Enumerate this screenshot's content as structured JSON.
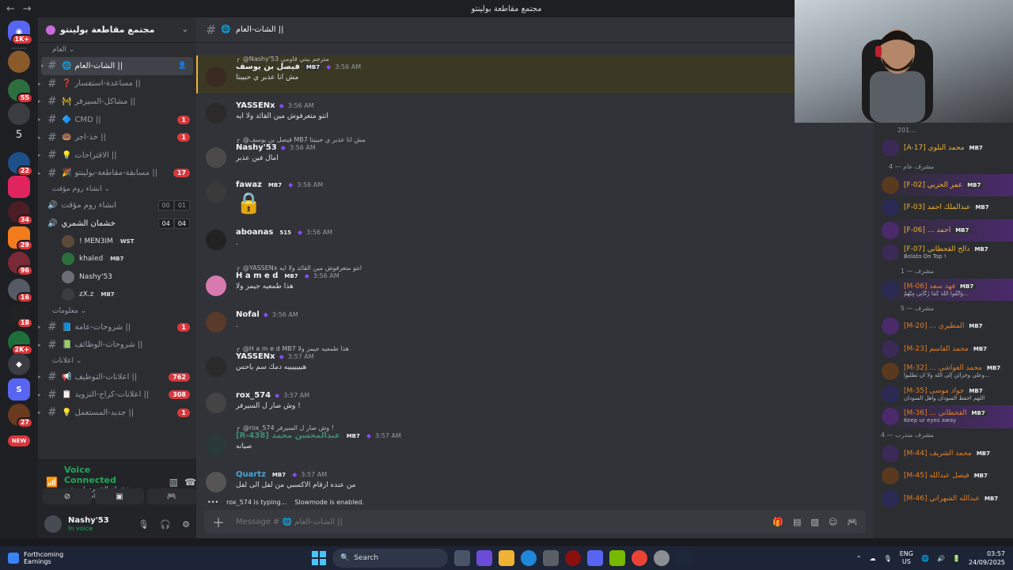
{
  "window": {
    "title": "مجتمع مقاطعة بولينتو"
  },
  "rail": {
    "badges": [
      "1K+",
      "55",
      "5",
      "22",
      "34",
      "29",
      "96",
      "16",
      "18",
      "2K+",
      "27",
      "NEW"
    ]
  },
  "server": {
    "name": "مجتمع مقاطعة بولينتو"
  },
  "sidebar": {
    "cat_general": "العام",
    "channels_general": [
      {
        "label": "الشات-العام ||",
        "emoji": "🌐",
        "active": true
      },
      {
        "label": "مساعدة-استفسار ||",
        "emoji": "❓"
      },
      {
        "label": "مشاكل-السيرفر ||",
        "emoji": "🚧"
      },
      {
        "label": "CMD ||",
        "emoji": "🔷",
        "unread": "1"
      },
      {
        "label": "خذ-اجر ||",
        "emoji": "🍩",
        "unread": "1"
      },
      {
        "label": "الاقتراحات ||",
        "emoji": "💡"
      },
      {
        "label": "مسابقة-مقاطعة-بولينتو ||",
        "emoji": "🎉",
        "unread": "17"
      }
    ],
    "cat_rooms": "انشاء روم مؤقت",
    "voice_create": {
      "label": "انشاء روم مؤقت",
      "c1": "00",
      "c2": "01"
    },
    "voice_room": {
      "label": "خشمان الشمري",
      "c1": "04",
      "c2": "04"
    },
    "voice_users": [
      {
        "name": "! MEN3IM",
        "tag": "WST"
      },
      {
        "name": "khaled",
        "tag": "MB7"
      },
      {
        "name": "Nashy'53",
        "tag": ""
      },
      {
        "name": "zX.z",
        "tag": "MB7"
      }
    ],
    "cat_info": "معلومات",
    "channels_info": [
      {
        "label": "شروحات-عامة ||",
        "emoji": "📘",
        "unread": "1"
      },
      {
        "label": "شروحات-الوظائف ||",
        "emoji": "📗"
      }
    ],
    "cat_ads": "اعلانات",
    "channels_ads": [
      {
        "label": "اعلانات-التوظيف ||",
        "emoji": "📢",
        "unread": "762"
      },
      {
        "label": "اعلانات-كراج-التزويد ||",
        "emoji": "📋",
        "unread": "308"
      },
      {
        "label": "جديد-المستعمل ||",
        "emoji": "💡",
        "unread": "1"
      }
    ]
  },
  "voice_panel": {
    "title": "Voice Connected",
    "subtitle": "خشمان الشمري / مجتمع مقاطعة بولينتو"
  },
  "user_panel": {
    "name": "Nashy'53",
    "status": "In voice"
  },
  "chat": {
    "channel": "الشات-العام ||",
    "messages": [
      {
        "reply": "@Nashy'53 مترجم يبتي قاومي",
        "name": "فيصل بن يوسف",
        "badge": "MB7",
        "time": "3:56 AM",
        "body": "مش انا عذبر ي حبيبتا"
      },
      {
        "reply": "",
        "name": "YASSENx",
        "badge": "",
        "time": "3:56 AM",
        "body": "انتو متعرفوش مين القائد ولا ايه"
      },
      {
        "reply": "@فيصل بن يوسف MB7 مش انا عذبر ي حبيبتا",
        "name": "Nashy'53",
        "badge": "",
        "time": "3:56 AM",
        "body": "امال فين عذبر"
      },
      {
        "reply": "",
        "name": "fawaz",
        "badge": "MB7",
        "time": "3:56 AM",
        "body": "🔒"
      },
      {
        "reply": "",
        "name": "aboanas",
        "badge": "515",
        "time": "3:56 AM",
        "body": "."
      },
      {
        "reply": "@YASSENx انتو متعرفوش مين القائد ولا ايه",
        "name": "H a m e d",
        "badge": "MB7",
        "time": "3:56 AM",
        "body": "هذا طمعيه جيمز ولا"
      },
      {
        "reply": "",
        "name": "Nofal",
        "badge": "",
        "time": "3:56 AM",
        "body": "."
      },
      {
        "reply": "@H a m e d MB7 هذا طمعيه جيمز ولا",
        "name": "YASSENx",
        "badge": "",
        "time": "3:57 AM",
        "body": "هيييييييه دمك سم ياحس"
      },
      {
        "reply": "",
        "name": "rox_574",
        "badge": "",
        "time": "3:57 AM",
        "body": "وش صار ل السيرفر !"
      },
      {
        "reply": "@rox_574 وش صار ل السيرفر !",
        "name": "[R-438] عبدالمحسن محمد",
        "badge": "MB7",
        "time": "3:57 AM",
        "body": "صيانه"
      },
      {
        "reply": "",
        "name": "Quartz",
        "badge": "MB7",
        "time": "3:57 AM",
        "body": "من عنده ارقام الاكسبي من لفل الى لفل"
      }
    ],
    "typing": "rox_574 is typing...",
    "slowmode": "Slowmode is enabled.",
    "placeholder": "Message # 🌐 الشات-العام ||"
  },
  "members": {
    "top_partial": "201...",
    "groups": [
      {
        "label": "",
        "members": [
          {
            "name": "[A-17] محمد البلوي",
            "color": "#f0b232",
            "sub": ""
          }
        ]
      },
      {
        "label": "مشرف عام — 4",
        "members": [
          {
            "name": "[F-02] عمر الحربي",
            "color": "#f0b232",
            "sub": ""
          },
          {
            "name": "[F-03] عبدالملك أحمد",
            "color": "#f0b232",
            "sub": ""
          },
          {
            "name": "[F-06] ... أحمد",
            "color": "#f0b232",
            "sub": ""
          },
          {
            "name": "[F-07] دالح القحطاني",
            "color": "#f0b232",
            "sub": "Bolato On Top !"
          }
        ]
      },
      {
        "label": "مشرف — 1",
        "members": [
          {
            "name": "[M-06] فهد سعد",
            "color": "#e67e22",
            "sub": "وَاتَّقُوا اللَّهَ كَمَا زَكَّانِي مِنْهُمْ..."
          }
        ]
      },
      {
        "label": "مشرف — 5",
        "members": [
          {
            "name": "[M-20] ... المطيري",
            "color": "#e67e22",
            "sub": ""
          },
          {
            "name": "[M-23] محمد القاسم",
            "color": "#e67e22",
            "sub": ""
          },
          {
            "name": "[M-32] ... محمد العواشي",
            "color": "#e67e22",
            "sub": "وعلي وخزائن إلى الله ولا ان تطلبوا..."
          },
          {
            "name": "[M-35] جواد موسى",
            "color": "#e67e22",
            "sub": "اللهم احفظ السودان واهل السودان"
          },
          {
            "name": "[M-36] ... القحطاني",
            "color": "#e67e22",
            "sub": "Keep ur eyes away"
          }
        ]
      },
      {
        "label": "مشرف متدرب — 4",
        "members": [
          {
            "name": "[M-44] محمد الشريف",
            "color": "#e67e22",
            "sub": ""
          },
          {
            "name": "[M-45] فيصل عبدالله",
            "color": "#e67e22",
            "sub": ""
          },
          {
            "name": "[M-46] عبدالله الشهراني",
            "color": "#e67e22",
            "sub": ""
          }
        ]
      }
    ]
  },
  "taskbar": {
    "news_title": "Forthcoming",
    "news_sub": "Earnings",
    "search": "Search",
    "lang1": "ENG",
    "lang2": "US",
    "time": "03:57",
    "date": "24/09/2025"
  },
  "colors": {
    "accent": "#5865f2",
    "online": "#23a55a",
    "unread": "#da373c"
  }
}
